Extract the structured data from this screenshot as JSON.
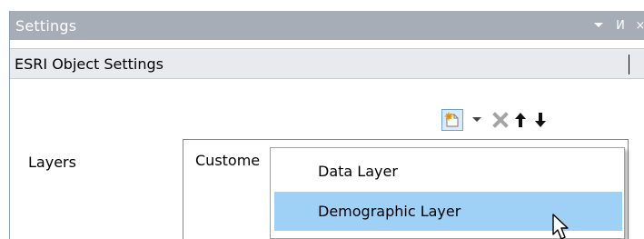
{
  "panel": {
    "title": "Settings",
    "controls": {
      "pin_glyph": "И",
      "close_glyph": "×"
    }
  },
  "section": {
    "title": "ESRI Object Settings"
  },
  "toolbar": {
    "buttons": [
      {
        "icon": "new-layer-icon"
      },
      {
        "icon": "chevron-down-icon"
      },
      {
        "icon": "delete-icon"
      },
      {
        "icon": "arrow-up-icon"
      },
      {
        "icon": "arrow-down-icon"
      }
    ]
  },
  "layers": {
    "label": "Layers",
    "items": [
      "Custome"
    ]
  },
  "menu": {
    "items": [
      {
        "label": "Data Layer",
        "highlighted": false
      },
      {
        "label": "Demographic Layer",
        "highlighted": true
      }
    ]
  },
  "colors": {
    "titlebar": "#a7adb6",
    "highlight": "#9fd0f5"
  }
}
